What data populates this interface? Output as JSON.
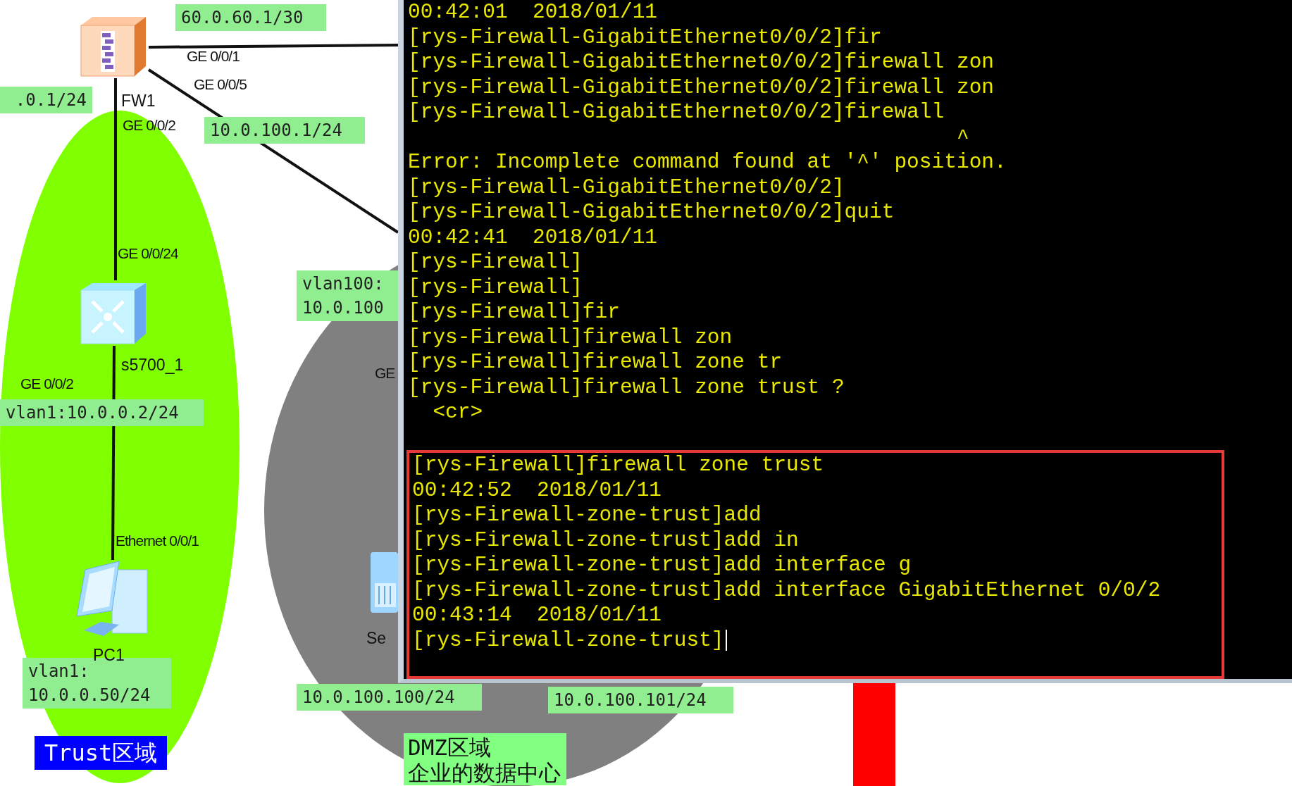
{
  "topology": {
    "zones": [
      {
        "kind": "trust",
        "label_lines": [
          "Trust区域"
        ]
      },
      {
        "kind": "dmz",
        "label_lines": [
          "DMZ区域",
          "企业的数据中心"
        ]
      }
    ],
    "devices": [
      {
        "kind": "firewall",
        "name": "FW1"
      },
      {
        "kind": "switch",
        "name": "s5700_1"
      },
      {
        "kind": "pc",
        "name": "PC1"
      },
      {
        "kind": "server",
        "name": "Se"
      }
    ],
    "port_labels": [
      "GE 0/0/1",
      "GE 0/0/5",
      "GE 0/0/2",
      "GE 0/0/24",
      "GE 0/0/2",
      "Ethernet 0/0/1",
      "GE"
    ],
    "address_labels": [
      "60.0.60.1/30",
      ".0.1/24",
      "10.0.100.1/24",
      "vlan100:\n10.0.100",
      "vlan1:10.0.0.2/24",
      "vlan1:\n10.0.0.50/24",
      "10.0.100.100/24",
      "10.0.100.101/24"
    ]
  },
  "terminal": {
    "lines": [
      "00:42:01  2018/01/11",
      "[rys-Firewall-GigabitEthernet0/0/2]fir",
      "[rys-Firewall-GigabitEthernet0/0/2]firewall zon",
      "[rys-Firewall-GigabitEthernet0/0/2]firewall zon",
      "[rys-Firewall-GigabitEthernet0/0/2]firewall",
      "                                            ^",
      "Error: Incomplete command found at '^' position.",
      "[rys-Firewall-GigabitEthernet0/0/2]",
      "[rys-Firewall-GigabitEthernet0/0/2]quit",
      "00:42:41  2018/01/11",
      "[rys-Firewall]",
      "[rys-Firewall]",
      "[rys-Firewall]fir",
      "[rys-Firewall]firewall zon",
      "[rys-Firewall]firewall zone tr",
      "[rys-Firewall]firewall zone trust ?",
      "  <cr>"
    ],
    "highlighted_lines": [
      "[rys-Firewall]firewall zone trust",
      "00:42:52  2018/01/11",
      "[rys-Firewall-zone-trust]add",
      "[rys-Firewall-zone-trust]add in",
      "[rys-Firewall-zone-trust]add interface g",
      "[rys-Firewall-zone-trust]add interface GigabitEthernet 0/0/2",
      "00:43:14  2018/01/11",
      "[rys-Firewall-zone-trust]"
    ]
  }
}
